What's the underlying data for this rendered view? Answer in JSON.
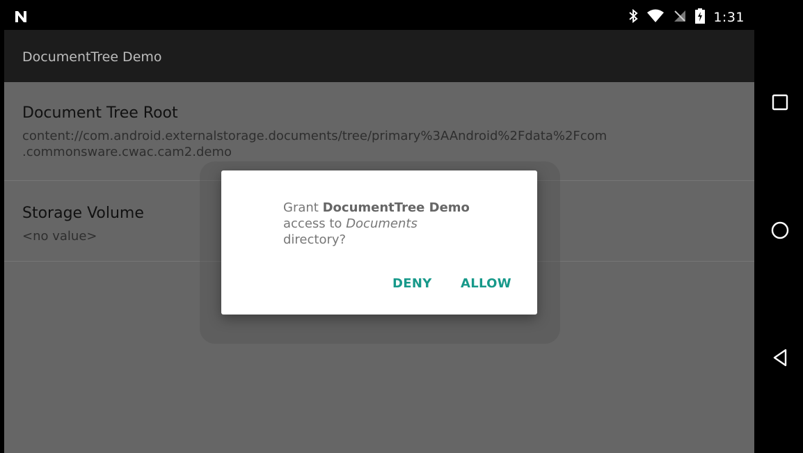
{
  "status_bar": {
    "time": "1:31",
    "icons": [
      "notification-n-icon",
      "bluetooth-icon",
      "wifi-icon",
      "no-sim-icon",
      "battery-charging-icon"
    ]
  },
  "app_bar": {
    "title": "DocumentTree Demo"
  },
  "preferences": [
    {
      "title": "Document Tree Root",
      "summary": "content://com.android.externalstorage.documents/tree/primary%3AAndroid%2Fdata%2Fcom\n.commonsware.cwac.cam2.demo"
    },
    {
      "title": "Storage Volume",
      "summary": "<no value>"
    }
  ],
  "dialog": {
    "message_prefix": "Grant",
    "app_name": "DocumentTree Demo",
    "message_middle": "access to",
    "directory": "Documents",
    "message_suffix": "directory?",
    "deny_label": "DENY",
    "allow_label": "ALLOW",
    "accent_color": "#17998a"
  },
  "nav_bar": {
    "buttons": [
      "recents-icon",
      "home-icon",
      "back-icon"
    ]
  }
}
